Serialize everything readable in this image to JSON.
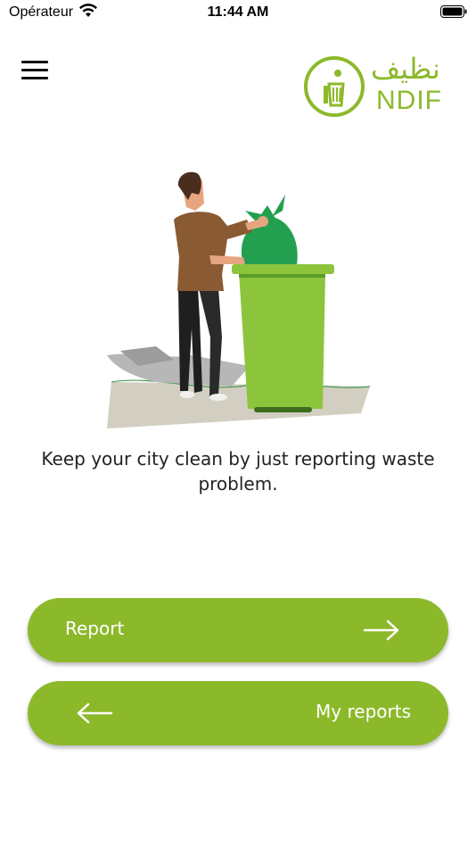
{
  "status_bar": {
    "carrier": "Opérateur",
    "time": "11:44 AM"
  },
  "header": {
    "menu_icon": "hamburger-menu-icon",
    "logo_text": "NDIF",
    "logo_arabic": "نظيف"
  },
  "main": {
    "illustration": "person-throwing-trash-bag-in-bin",
    "tagline": "Keep your city clean by just reporting waste problem."
  },
  "actions": {
    "report_label": "Report",
    "report_icon": "arrow-right-icon",
    "my_reports_label": "My reports",
    "my_reports_icon": "arrow-left-icon"
  },
  "colors": {
    "brand": "#8cb92a",
    "bag": "#1e9a4a",
    "shirt": "#8a5a32",
    "pants": "#1f1f1f"
  }
}
